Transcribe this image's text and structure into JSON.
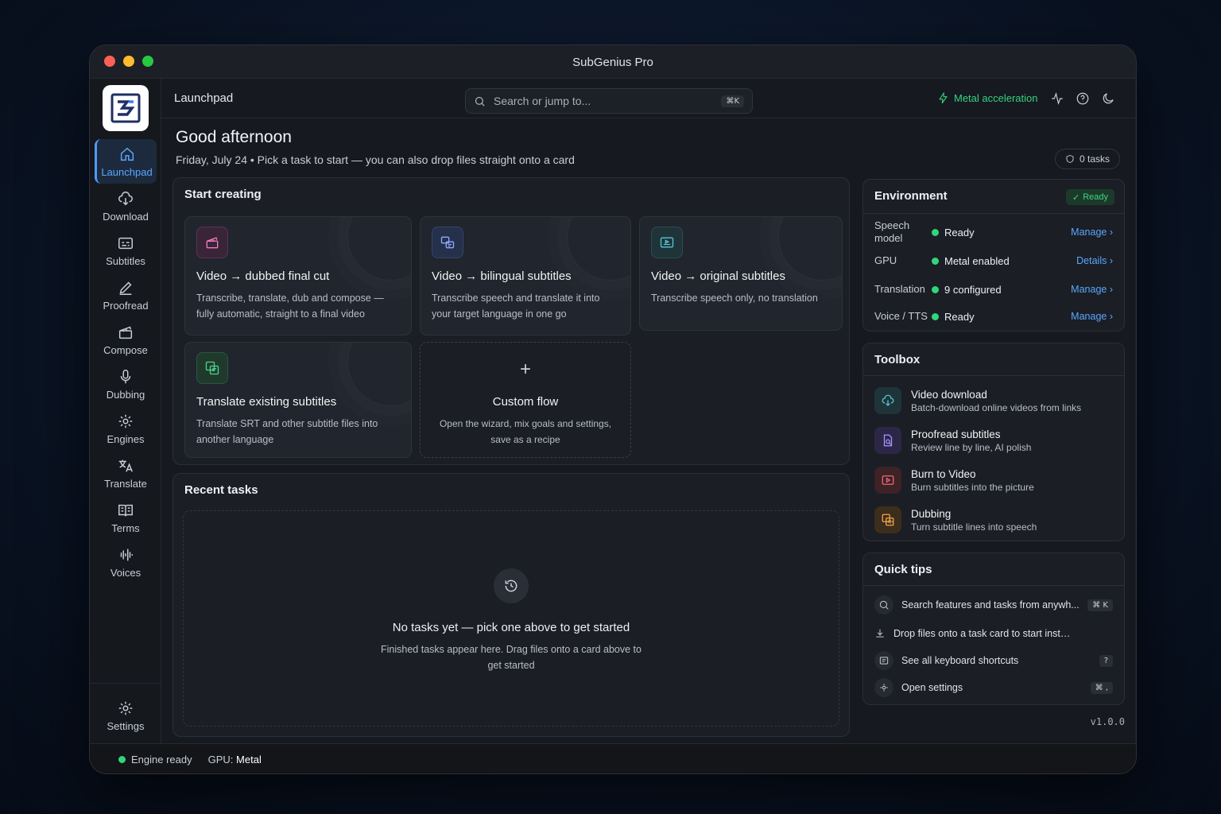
{
  "window": {
    "title": "SubGenius Pro"
  },
  "sidebar": {
    "items": [
      {
        "label": "Launchpad",
        "icon": "home-icon",
        "active": true
      },
      {
        "label": "Download",
        "icon": "cloud-download-icon"
      },
      {
        "label": "Subtitles",
        "icon": "subtitles-icon"
      },
      {
        "label": "Proofread",
        "icon": "pen-icon"
      },
      {
        "label": "Compose",
        "icon": "clapperboard-icon"
      },
      {
        "label": "Dubbing",
        "icon": "microphone-icon"
      },
      {
        "label": "Engines",
        "icon": "gear-icon"
      },
      {
        "label": "Translate",
        "icon": "translate-icon"
      },
      {
        "label": "Terms",
        "icon": "book-icon"
      },
      {
        "label": "Voices",
        "icon": "waveform-icon"
      }
    ],
    "settings_label": "Settings"
  },
  "topbar": {
    "breadcrumb": "Launchpad",
    "search_placeholder": "Search or jump to...",
    "search_shortcut": "⌘K",
    "acceleration": "Metal acceleration"
  },
  "header": {
    "greeting": "Good afternoon",
    "subline": "Friday, July 24 • Pick a task to start — you can also drop files straight onto a card",
    "tasks_count": "0 tasks"
  },
  "start_creating": {
    "title": "Start creating",
    "cards": [
      {
        "title": "Video → dubbed final cut",
        "desc": "Transcribe, translate, dub and compose — fully automatic, straight to a final video"
      },
      {
        "title": "Video → bilingual subtitles",
        "desc": "Transcribe speech and translate it into your target language in one go"
      },
      {
        "title": "Video → original subtitles",
        "desc": "Transcribe speech only, no translation"
      },
      {
        "title": "Translate existing subtitles",
        "desc": "Translate SRT and other subtitle files into another language"
      }
    ],
    "custom": {
      "title": "Custom flow",
      "desc": "Open the wizard, mix goals and settings, save as a recipe"
    }
  },
  "recent": {
    "title": "Recent tasks",
    "empty_title": "No tasks yet — pick one above to get started",
    "empty_desc": "Finished tasks appear here. Drag files onto a card above to get started"
  },
  "environment": {
    "title": "Environment",
    "status": "Ready",
    "rows": [
      {
        "key": "Speech model",
        "value": "Ready",
        "action": "Manage"
      },
      {
        "key": "GPU",
        "value": "Metal enabled",
        "action": "Details"
      },
      {
        "key": "Translation",
        "value": "9 configured",
        "action": "Manage"
      },
      {
        "key": "Voice / TTS",
        "value": "Ready",
        "action": "Manage"
      }
    ]
  },
  "toolbox": {
    "title": "Toolbox",
    "items": [
      {
        "title": "Video download",
        "desc": "Batch-download online videos from links"
      },
      {
        "title": "Proofread subtitles",
        "desc": "Review line by line, AI polish"
      },
      {
        "title": "Burn to Video",
        "desc": "Burn subtitles into the picture"
      },
      {
        "title": "Dubbing",
        "desc": "Turn subtitle lines into speech"
      }
    ]
  },
  "tips": {
    "title": "Quick tips",
    "items": [
      {
        "text": "Search features and tasks from anywh...",
        "key": "⌘ K"
      },
      {
        "text": "Drop files onto a task card to start instantly",
        "key": ""
      },
      {
        "text": "See all keyboard shortcuts",
        "key": "?"
      },
      {
        "text": "Open settings",
        "key": "⌘ ,"
      }
    ]
  },
  "statusbar": {
    "engine": "Engine ready",
    "gpu_label": "GPU:",
    "gpu_value": "Metal"
  },
  "version": "v1.0.0",
  "colors": {
    "accent": "#5aa6ff",
    "success": "#35d37f",
    "background": "#16191f"
  }
}
